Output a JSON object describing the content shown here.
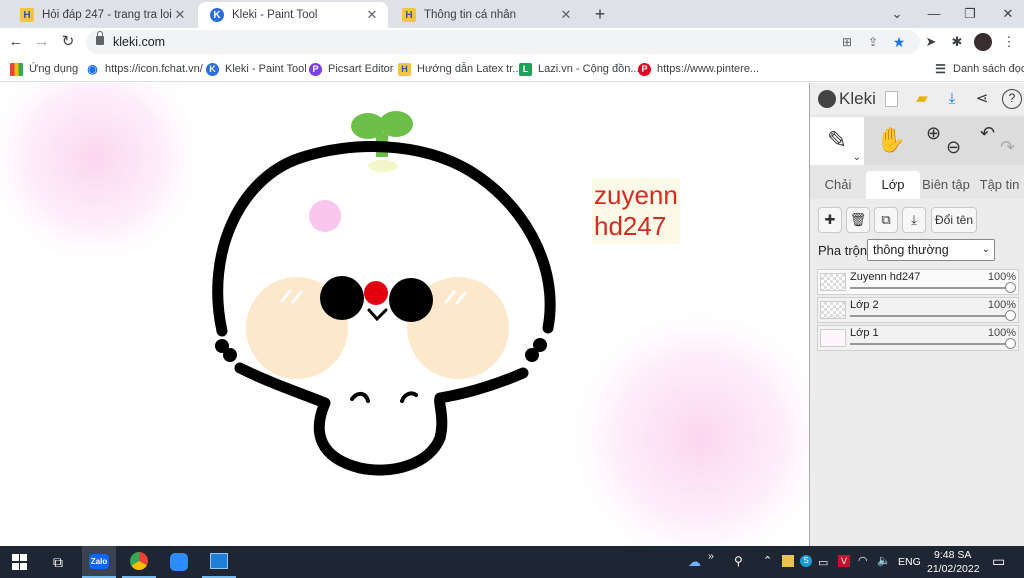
{
  "browser": {
    "tabs": [
      {
        "title": "Hỏi đáp 247 - trang tra loi",
        "favicon": "h-favicon",
        "active": false
      },
      {
        "title": "Kleki - Paint Tool",
        "favicon": "kleki-favicon",
        "active": true
      },
      {
        "title": "Thông tin cá nhân",
        "favicon": "h-favicon",
        "active": false
      }
    ],
    "url": "kleki.com",
    "bookmarks": [
      {
        "label": "Ứng dụng",
        "icon": "apps-grid-icon"
      },
      {
        "label": "https://icon.fchat.vn/",
        "icon": "eye-icon"
      },
      {
        "label": "Kleki - Paint Tool",
        "icon": "kleki-icon"
      },
      {
        "label": "Picsart Editor",
        "icon": "picsart-icon"
      },
      {
        "label": "Hướng dẫn Latex tr...",
        "icon": "h-favicon"
      },
      {
        "label": "Lazi.vn - Cộng đồn...",
        "icon": "lazi-icon"
      },
      {
        "label": "https://www.pintere...",
        "icon": "pinterest-icon"
      }
    ],
    "reading_list": "Danh sách đọc"
  },
  "canvas": {
    "text_line1": "zuyenn",
    "text_line2": "hd247"
  },
  "kleki": {
    "logo": "Kleki",
    "tabs": [
      "Chải",
      "Lớp",
      "Biên tập",
      "Tập tin"
    ],
    "active_tab": "Lớp",
    "rename_label": "Đổi tên",
    "blend_label": "Pha trộn",
    "blend_value": "thông thường",
    "layers": [
      {
        "name": "Zuyenn hd247",
        "opacity": "100%",
        "selected": true
      },
      {
        "name": "Lớp 2",
        "opacity": "100%",
        "selected": false
      },
      {
        "name": "Lớp 1",
        "opacity": "100%",
        "selected": false
      }
    ]
  },
  "taskbar": {
    "lang": "ENG",
    "time": "9:48 SA",
    "date": "21/02/2022"
  }
}
